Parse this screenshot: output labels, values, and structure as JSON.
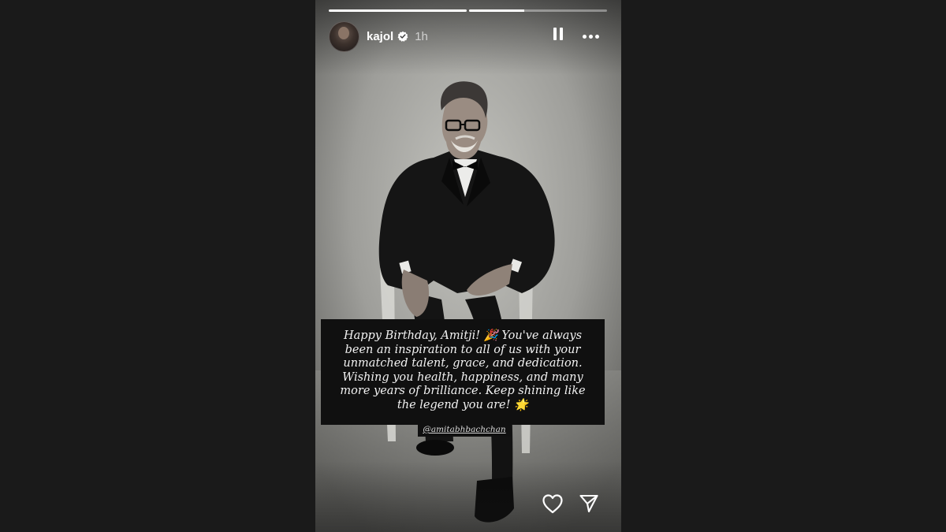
{
  "story": {
    "progress": [
      1.0,
      0.4,
      0.0
    ],
    "user": {
      "username": "kajol",
      "verified": true,
      "posted_ago": "1h"
    },
    "controls": {
      "pause_icon": "pause-icon",
      "more_icon": "more-options-icon"
    },
    "caption": {
      "text": "Happy Birthday, Amitji! 🎉 You've always\nbeen an inspiration to all of us with your\nunmatched talent, grace, and dedication.\nWishing you health, happiness, and many\nmore years of brilliance. Keep shining like\nthe legend you are! 🌟",
      "mention": "@amitabhbachchan"
    },
    "actions": {
      "like_icon": "heart-icon",
      "share_icon": "send-icon"
    },
    "colors": {
      "background": "#1a1a1a",
      "caption_bg": "#101010",
      "text": "#ffffff"
    }
  }
}
